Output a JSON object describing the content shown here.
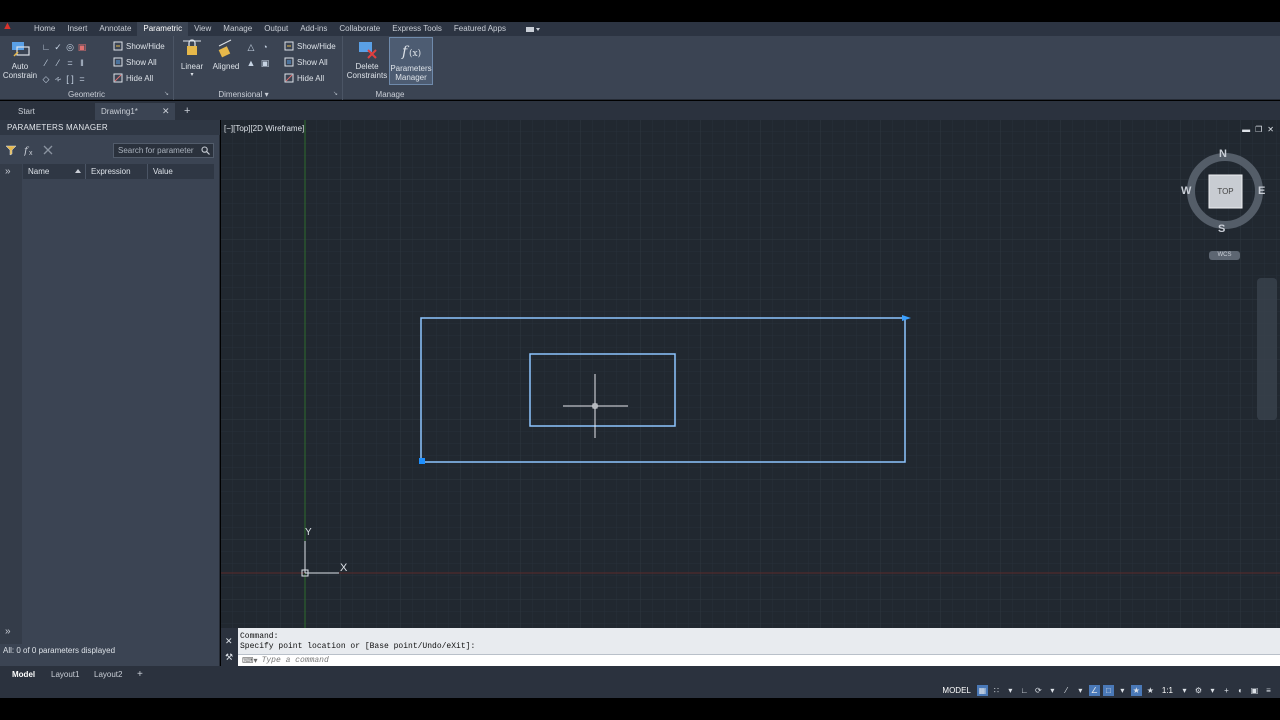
{
  "ribbon": {
    "tabs": [
      {
        "label": "Home",
        "active": false
      },
      {
        "label": "Insert",
        "active": false
      },
      {
        "label": "Annotate",
        "active": false
      },
      {
        "label": "Parametric",
        "active": true
      },
      {
        "label": "View",
        "active": false
      },
      {
        "label": "Manage",
        "active": false
      },
      {
        "label": "Output",
        "active": false
      },
      {
        "label": "Add-ins",
        "active": false
      },
      {
        "label": "Collaborate",
        "active": false
      },
      {
        "label": "Express Tools",
        "active": false
      },
      {
        "label": "Featured Apps",
        "active": false
      }
    ],
    "geometric": {
      "label": "Geometric",
      "auto_constrain": "Auto\nConstrain",
      "auto_constrain_line1": "Auto",
      "auto_constrain_line2": "Constrain",
      "show_hide": "Show/Hide",
      "show_all": "Show All",
      "hide_all": "Hide All"
    },
    "dimensional": {
      "label": "Dimensional",
      "linear": "Linear",
      "aligned": "Aligned",
      "show_hide": "Show/Hide",
      "show_all": "Show All",
      "hide_all": "Hide All"
    },
    "manage": {
      "label": "Manage",
      "delete_line1": "Delete",
      "delete_line2": "Constraints",
      "params_line1": "Parameters",
      "params_line2": "Manager"
    }
  },
  "file_tabs": {
    "start": "Start",
    "drawing": "Drawing1*"
  },
  "palette": {
    "title": "PARAMETERS MANAGER",
    "search_placeholder": "Search for parameter",
    "columns": {
      "name": "Name",
      "expression": "Expression",
      "value": "Value"
    },
    "status": "All: 0 of 0 parameters displayed"
  },
  "viewport": {
    "label": "[−][Top][2D Wireframe]",
    "viewcube": {
      "n": "N",
      "s": "S",
      "e": "E",
      "w": "W",
      "face": "TOP",
      "wcs": "WCS"
    },
    "ucs": {
      "x": "X",
      "y": "Y"
    }
  },
  "command": {
    "history_1": "Command:",
    "history_2": "Specify point location or [Base point/Undo/eXit]:",
    "placeholder": "Type a command"
  },
  "layouts": {
    "model": "Model",
    "layout1": "Layout1",
    "layout2": "Layout2"
  },
  "status": {
    "model": "MODEL",
    "scale": "1:1"
  },
  "colors": {
    "canvas": "#212830",
    "grip": "#1e90ff",
    "selection": "#8ec5ff"
  }
}
